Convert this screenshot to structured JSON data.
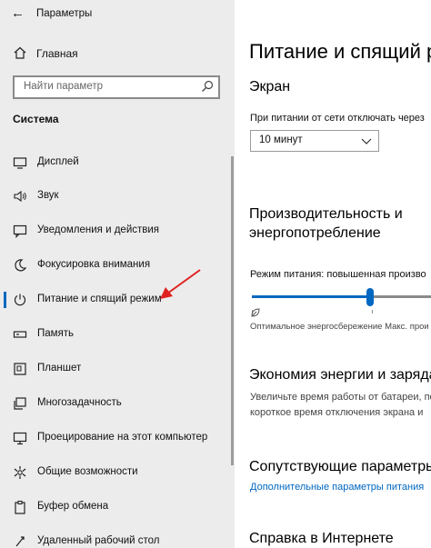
{
  "window": {
    "title": "Параметры"
  },
  "sidebar": {
    "home_label": "Главная",
    "search_placeholder": "Найти параметр",
    "section_title": "Система",
    "items": [
      {
        "label": "Дисплей",
        "icon": "monitor-icon"
      },
      {
        "label": "Звук",
        "icon": "speaker-icon"
      },
      {
        "label": "Уведомления и действия",
        "icon": "notification-icon"
      },
      {
        "label": "Фокусировка внимания",
        "icon": "moon-icon"
      },
      {
        "label": "Питание и спящий режим",
        "icon": "power-icon",
        "active": true
      },
      {
        "label": "Память",
        "icon": "storage-icon"
      },
      {
        "label": "Планшет",
        "icon": "tablet-icon"
      },
      {
        "label": "Многозадачность",
        "icon": "multitask-icon"
      },
      {
        "label": "Проецирование на этот компьютер",
        "icon": "project-icon"
      },
      {
        "label": "Общие возможности",
        "icon": "shared-icon"
      },
      {
        "label": "Буфер обмена",
        "icon": "clipboard-icon"
      },
      {
        "label": "Удаленный рабочий стол",
        "icon": "remote-desktop-icon"
      }
    ]
  },
  "main": {
    "title": "Питание и спящий р",
    "screen_heading": "Экран",
    "screen_off_label": "При питании от сети отключать через",
    "screen_off_value": "10 минут",
    "performance_heading_1": "Производительность и",
    "performance_heading_2": "энергопотребление",
    "power_mode_label": "Режим питания: повышенная произво",
    "slider_left_label": "Оптимальное энергосбережение Макс. прои",
    "slider_level": 0.65,
    "energy_heading": "Экономия энергии и заряда",
    "energy_text_1": "Увеличьте время работы от батареи, по",
    "energy_text_2": "короткое время отключения экрана и",
    "related_heading": "Сопутствующие параметры",
    "related_link": "Дополнительные параметры питания",
    "help_heading": "Справка в Интернете"
  },
  "colors": {
    "accent": "#0067c0",
    "sidebar_bg": "#ececec",
    "annotation_arrow": "#e02020"
  }
}
